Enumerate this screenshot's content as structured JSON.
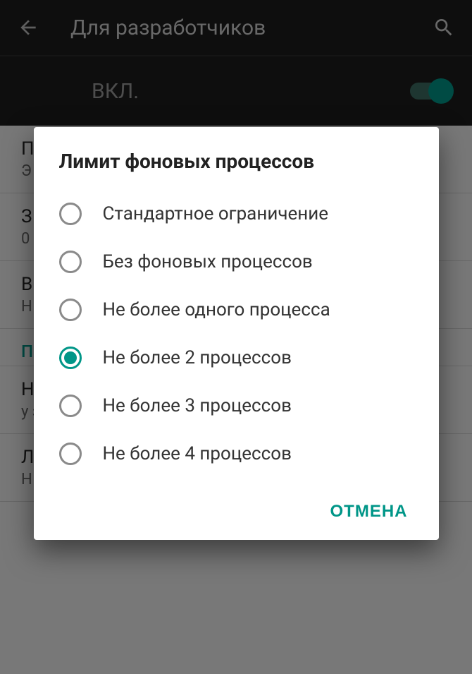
{
  "header": {
    "title": "Для разработчиков"
  },
  "master_switch": {
    "label": "ВКЛ.",
    "on": true
  },
  "background_rows": [
    {
      "title": "П",
      "sub": "Э\nза"
    },
    {
      "title": "З",
      "sub": "0"
    },
    {
      "title": "В",
      "sub": "Н"
    }
  ],
  "background_section": "П",
  "background_rows2": [
    {
      "title": "Н",
      "sub": "у\nза"
    },
    {
      "title": "Л",
      "sub": "Н"
    }
  ],
  "dialog": {
    "title": "Лимит фоновых процессов",
    "options": [
      {
        "label": "Стандартное ограничение",
        "selected": false
      },
      {
        "label": "Без фоновых процессов",
        "selected": false
      },
      {
        "label": "Не более одного процесса",
        "selected": false
      },
      {
        "label": "Не более 2 процессов",
        "selected": true
      },
      {
        "label": "Не более 3 процессов",
        "selected": false
      },
      {
        "label": "Не более 4 процессов",
        "selected": false
      }
    ],
    "cancel_label": "ОТМЕНА"
  }
}
